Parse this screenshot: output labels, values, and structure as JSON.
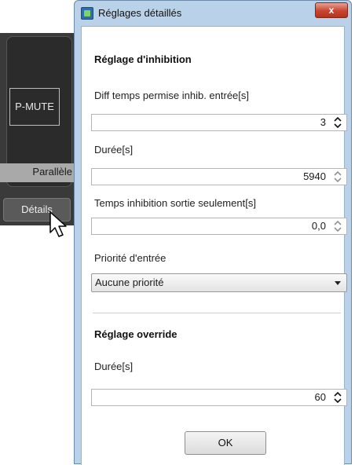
{
  "background_panel": {
    "mode_box_label": "P-MUTE",
    "mode_label": "Parallèle",
    "details_button_label": "Détails"
  },
  "dialog": {
    "title": "Réglages détaillés",
    "close_label": "x",
    "inhibition": {
      "heading": "Réglage d'inhibition",
      "fields": [
        {
          "label": "Diff temps permise inhib. entrée[s]",
          "value": "3"
        },
        {
          "label": "Durée[s]",
          "value": "5940"
        },
        {
          "label": "Temps inhibition sortie seulement[s]",
          "value": "0,0"
        }
      ],
      "priority": {
        "label": "Priorité d'entrée",
        "selected": "Aucune priorité"
      }
    },
    "override": {
      "heading": "Réglage override",
      "field": {
        "label": "Durée[s]",
        "value": "60"
      }
    },
    "ok_label": "OK"
  },
  "colors": {
    "window_frame": "#b9d2ea",
    "close_button": "#c8452f",
    "background_panel": "#3a3a3a"
  }
}
